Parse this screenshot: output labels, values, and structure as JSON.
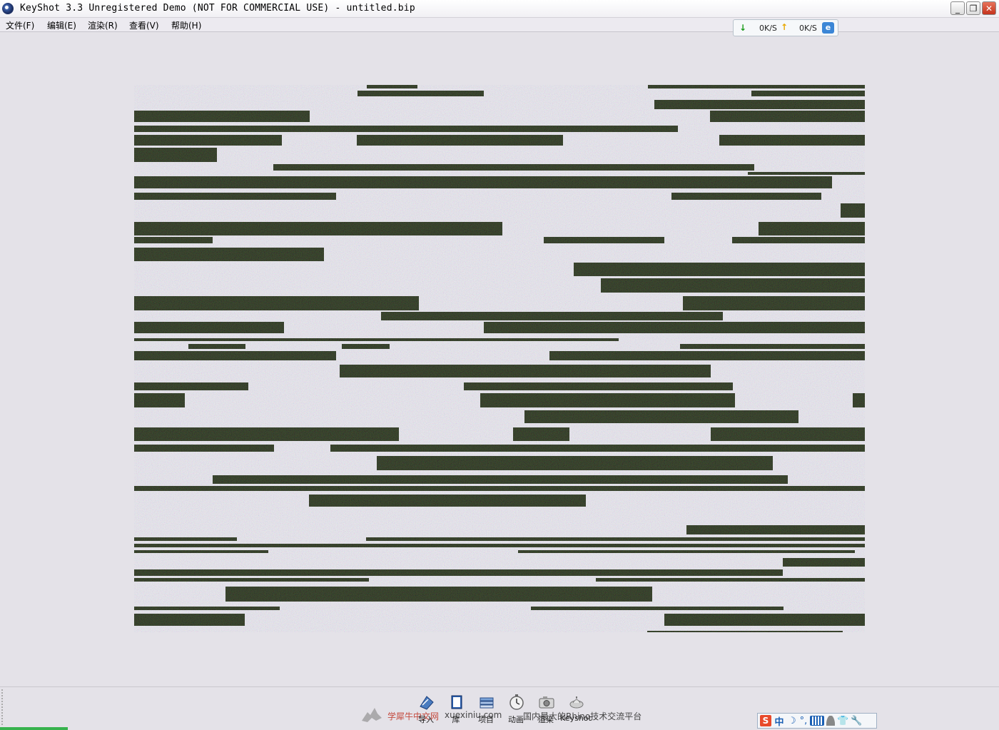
{
  "window": {
    "title": "KeyShot 3.3 Unregistered Demo (NOT FOR COMMERCIAL USE) - untitled.bip",
    "minimize_glyph": "_",
    "restore_glyph": "❐",
    "close_glyph": "✕"
  },
  "menu": {
    "items": [
      {
        "label": "文件(F)"
      },
      {
        "label": "编辑(E)"
      },
      {
        "label": "渲染(R)"
      },
      {
        "label": "查看(V)"
      },
      {
        "label": "帮助(H)"
      }
    ]
  },
  "speed_widget": {
    "download": "0K/S",
    "upload": "0K/S",
    "download_icon": "↓",
    "upload_icon": "↑",
    "browser_icon": "e"
  },
  "toolbar": {
    "buttons": [
      {
        "label": "导入",
        "icon": "import-icon"
      },
      {
        "label": "库",
        "icon": "library-icon"
      },
      {
        "label": "项目",
        "icon": "project-icon"
      },
      {
        "label": "动画",
        "icon": "animation-icon"
      },
      {
        "label": "渲染",
        "icon": "render-icon"
      },
      {
        "label": "Keyshot",
        "icon": "keyshot-icon"
      }
    ]
  },
  "watermark": {
    "brand": "学犀牛中文网",
    "url": "xuexiniu.com",
    "slogan": "国内最大的Rhino技术交流平台"
  },
  "ime": {
    "logo": "S",
    "mode": "中",
    "moon": "☽",
    "punct": "°,",
    "shirt": "👕",
    "wrench": "🔧"
  },
  "colors": {
    "background": "#e4e2e8",
    "noise_light": "#d8d6e0",
    "noise_dark": "#2d3524",
    "progress": "#37b24d"
  }
}
